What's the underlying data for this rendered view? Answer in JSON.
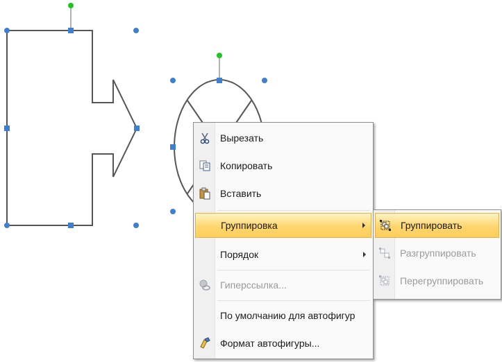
{
  "context_menu": {
    "items": [
      {
        "id": "cut",
        "label": "Вырезать",
        "icon": "scissors-icon",
        "enabled": true
      },
      {
        "id": "copy",
        "label": "Копировать",
        "icon": "copy-icon",
        "enabled": true
      },
      {
        "id": "paste",
        "label": "Вставить",
        "icon": "paste-icon",
        "enabled": true
      },
      {
        "id": "grouping",
        "label": "Группировка",
        "has_submenu": true,
        "highlighted": true,
        "enabled": true
      },
      {
        "id": "order",
        "label": "Порядок",
        "has_submenu": true,
        "enabled": true
      },
      {
        "id": "hyperlink",
        "label": "Гиперссылка...",
        "icon": "hyperlink-icon",
        "enabled": false
      },
      {
        "id": "default-autoshape",
        "label": "По умолчанию для автофигур",
        "enabled": true
      },
      {
        "id": "format-autoshape",
        "label": "Формат автофигуры...",
        "icon": "format-brush-icon",
        "enabled": true
      }
    ]
  },
  "submenu": {
    "items": [
      {
        "id": "group",
        "label": "Группировать",
        "icon": "group-icon",
        "highlighted": true,
        "enabled": true
      },
      {
        "id": "ungroup",
        "label": "Разгруппировать",
        "icon": "ungroup-icon",
        "enabled": false
      },
      {
        "id": "regroup",
        "label": "Перегруппировать",
        "icon": "regroup-icon",
        "enabled": false
      }
    ]
  },
  "colors": {
    "highlight": "#ffd66e",
    "selection_handle": "#3f7fce",
    "rotation_handle": "#22c322",
    "shape_outline": "#555555",
    "disabled_text": "#9a9a9a"
  }
}
